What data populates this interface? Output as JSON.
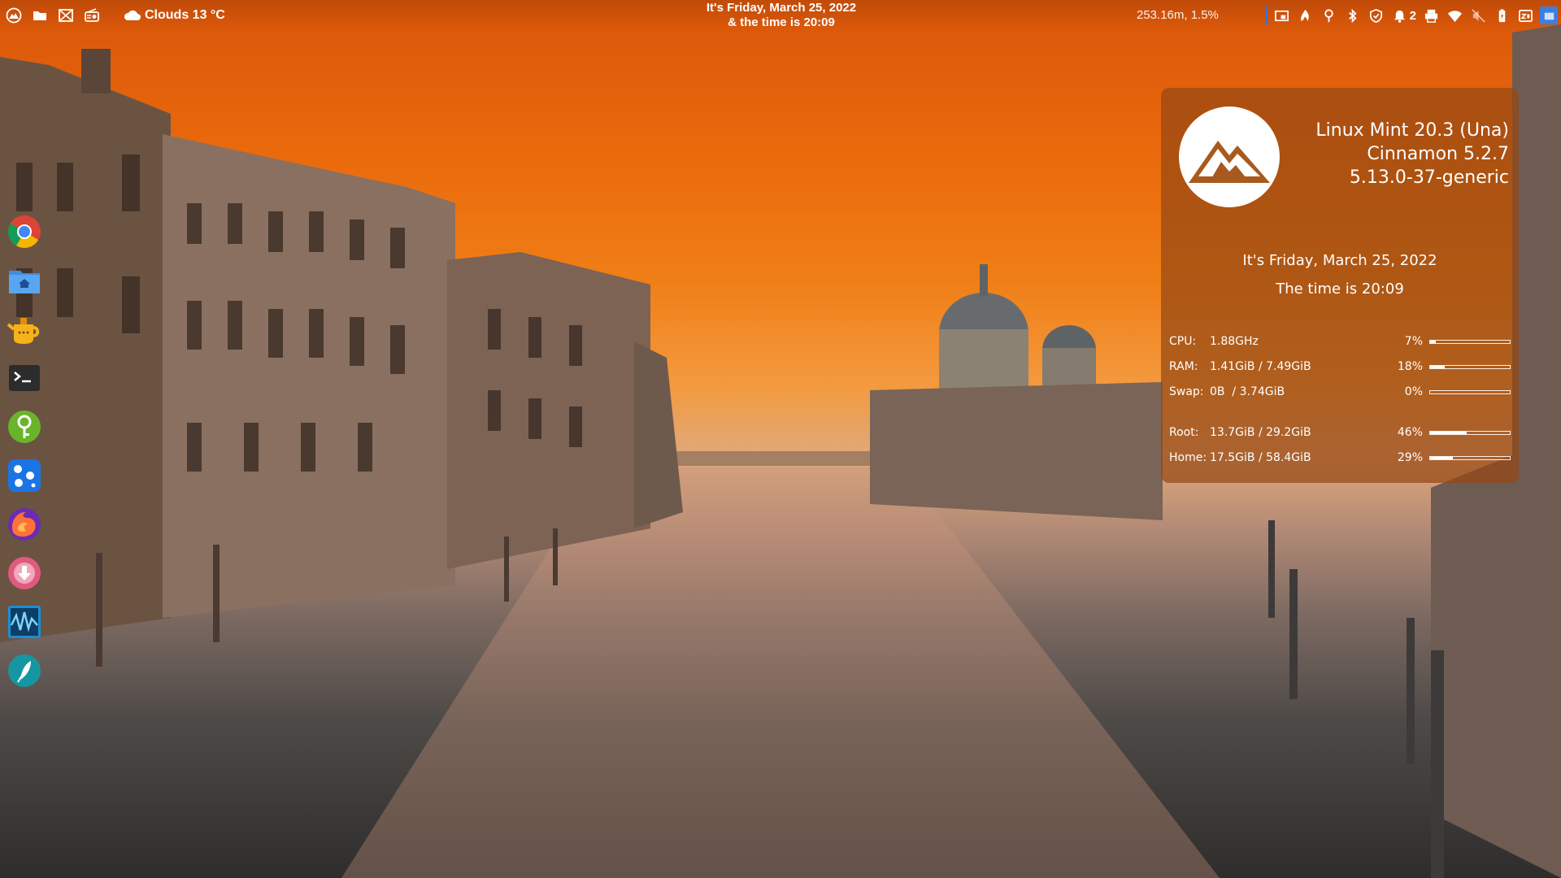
{
  "panel": {
    "left_icons": [
      "mint-menu-icon",
      "files-icon",
      "mail-icon",
      "radio-icon"
    ],
    "weather": {
      "icon": "cloud-icon",
      "text": "Clouds 13 °C"
    },
    "clock": {
      "line1": "It's Friday, March 25, 2022",
      "line2": "& the time is 20:09"
    },
    "net_stats": "253.16m, 1.5%",
    "tray": {
      "icons": [
        "screenshot-icon",
        "flame-icon",
        "pin-icon",
        "bluetooth-icon",
        "shield-icon",
        "notification-icon",
        "printer-icon",
        "wifi-icon",
        "mute-icon",
        "battery-icon",
        "keyboard-icon",
        "workspace-icon"
      ],
      "notification_count": "2"
    }
  },
  "dock": {
    "apps": [
      "chrome-icon",
      "home-folder-icon",
      "teapot-icon",
      "terminal-icon",
      "keepass-icon",
      "dots-app-icon",
      "firefox-icon",
      "download-icon",
      "waveform-icon",
      "pen-app-icon"
    ]
  },
  "conky": {
    "distro": [
      "Linux Mint 20.3 (Una)",
      "Cinnamon 5.2.7",
      "5.13.0-37-generic"
    ],
    "date": "It's Friday, March 25, 2022",
    "time": "The time is 20:09",
    "metrics": [
      {
        "label": "CPU:",
        "value": "1.88GHz",
        "percent_text": "7%",
        "percent": 7
      },
      {
        "label": "RAM:",
        "value": "1.41GiB / 7.49GiB",
        "percent_text": "18%",
        "percent": 18
      },
      {
        "label": "Swap:",
        "value": "0B  / 3.74GiB",
        "percent_text": "0%",
        "percent": 0
      },
      {
        "label": "Root:",
        "value": "13.7GiB / 29.2GiB",
        "percent_text": "46%",
        "percent": 46
      },
      {
        "label": "Home:",
        "value": "17.5GiB / 58.4GiB",
        "percent_text": "29%",
        "percent": 29
      }
    ]
  },
  "colors": {
    "sky_top": "#d9550a",
    "sky_mid": "#f07e16",
    "conky_bg": "#964814",
    "panel_accent": "#3d7fe0"
  }
}
